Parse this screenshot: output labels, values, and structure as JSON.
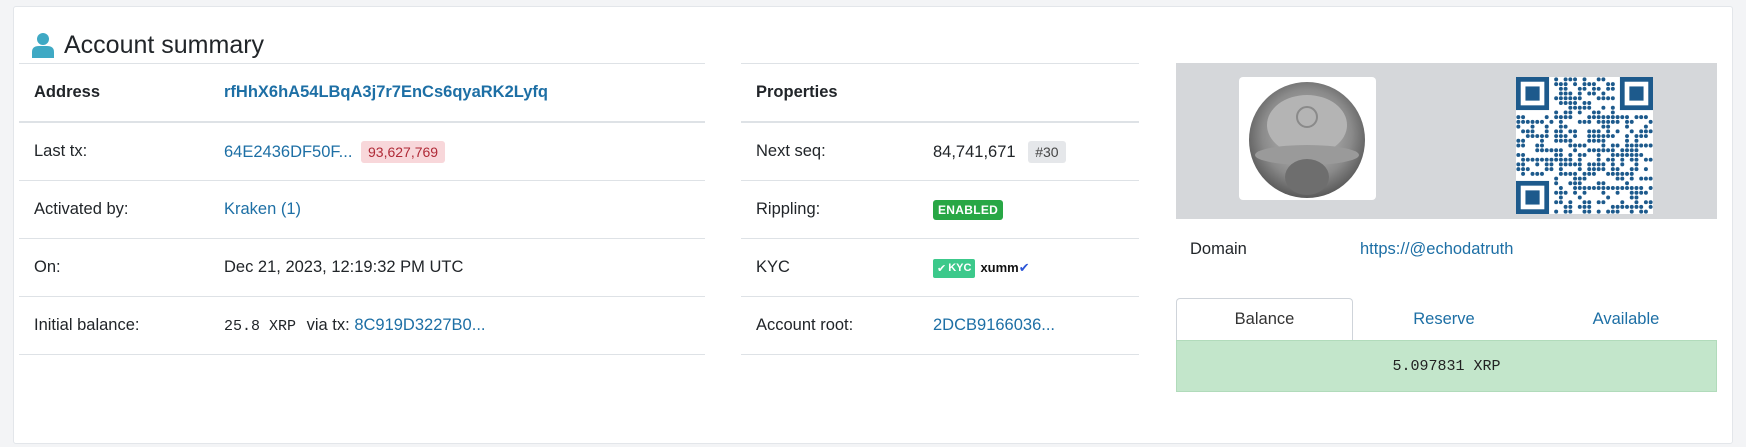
{
  "header": {
    "title": "Account summary",
    "icon": "user-icon"
  },
  "left_table": {
    "header_label": "Address",
    "address": "rfHhX6hA54LBqA3j7r7EnCs6qyaRK2Lyfq",
    "rows": [
      {
        "label": "Last tx:",
        "value": "64E2436DF50F...",
        "badge": "93,627,769"
      },
      {
        "label": "Activated by:",
        "value": "Kraken (1)"
      },
      {
        "label": "On:",
        "value": "Dec 21, 2023, 12:19:32 PM UTC"
      },
      {
        "label": "Initial balance:",
        "amount": "25.8 XRP",
        "via": "via tx:",
        "tx": "8C919D3227B0..."
      }
    ]
  },
  "properties": {
    "header_label": "Properties",
    "next_seq_label": "Next seq:",
    "next_seq_value": "84,741,671",
    "next_seq_badge": "#30",
    "rippling_label": "Rippling:",
    "rippling_value": "ENABLED",
    "kyc_label": "KYC",
    "kyc_badge": "KYC",
    "kyc_provider": "xumm",
    "account_root_label": "Account root:",
    "account_root_value": "2DCB9166036..."
  },
  "side": {
    "domain_label": "Domain",
    "domain_value": "https://@echodatruth",
    "tabs": [
      "Balance",
      "Reserve",
      "Available"
    ],
    "active_tab": "Balance",
    "balance_value": "5.097831 XRP"
  },
  "colors": {
    "link": "#1d6fa5",
    "danger_badge_bg": "#f8d7da",
    "enabled_green": "#28a745",
    "balance_bg": "#c3e6cb",
    "icon_teal": "#3fa9c4"
  }
}
